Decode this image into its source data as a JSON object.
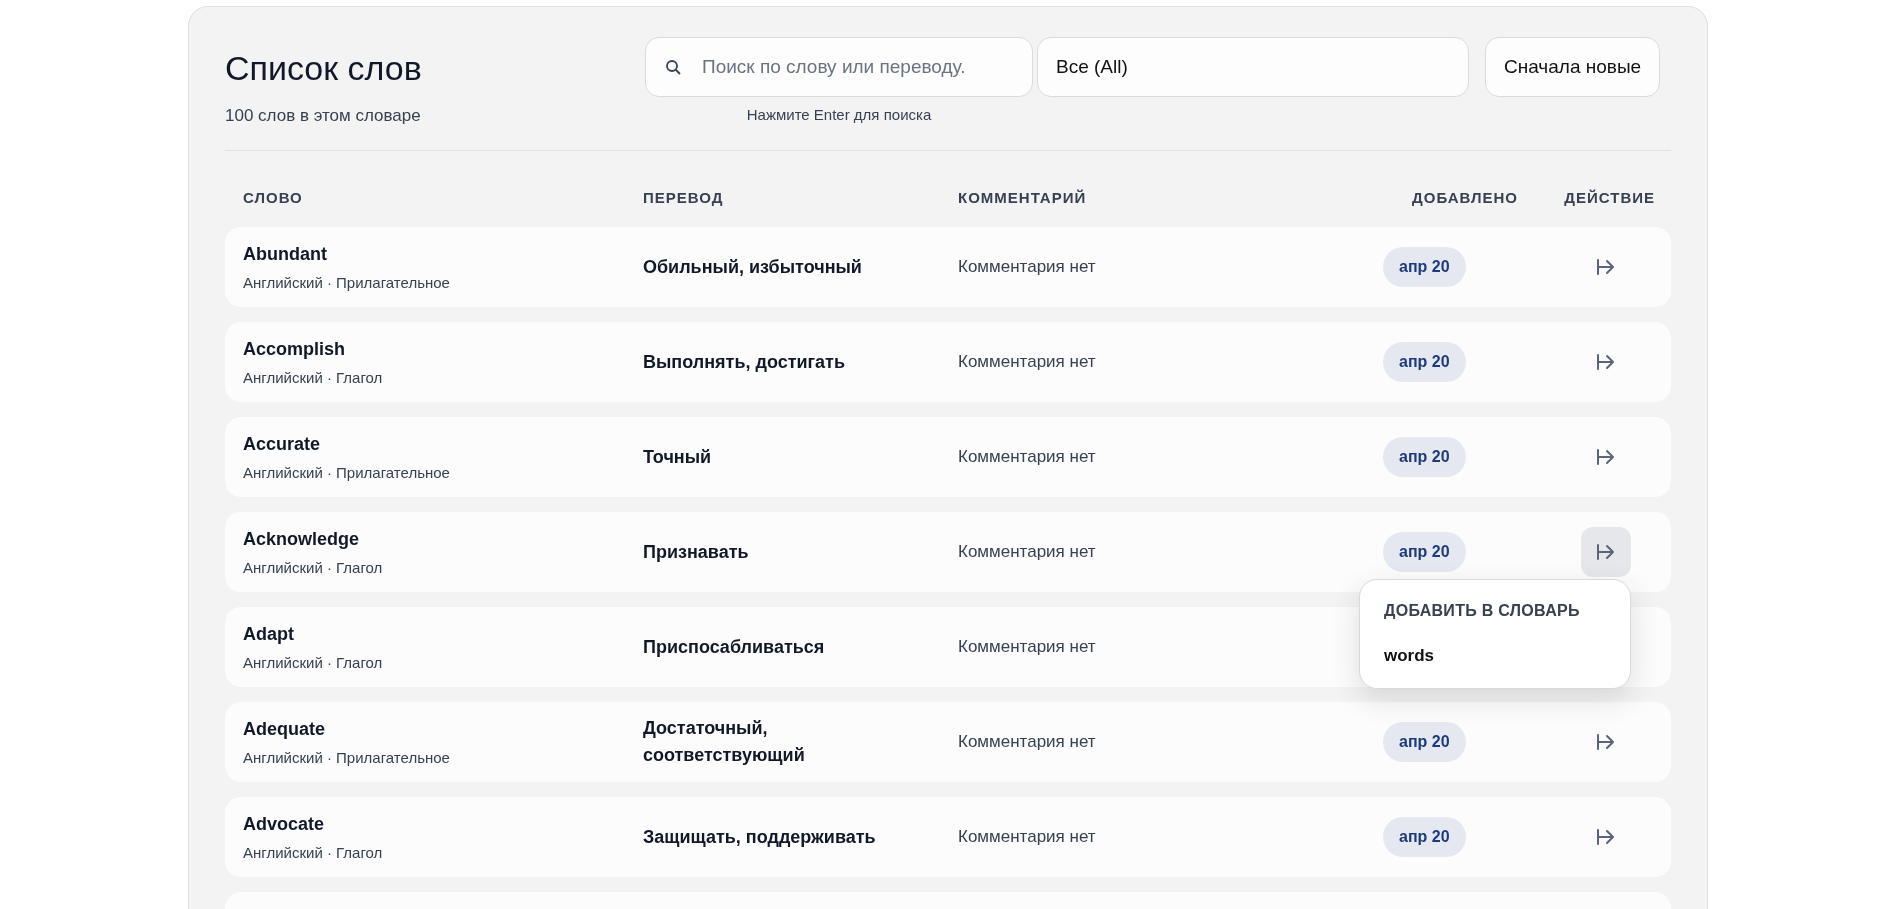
{
  "header": {
    "title": "Список слов",
    "subtitle": "100 слов в этом словаре"
  },
  "search": {
    "placeholder": "Поиск по слову или переводу.",
    "hint": "Нажмите Enter для поиска"
  },
  "filter": {
    "value": "Все (All)"
  },
  "sort": {
    "label": "Сначала новые"
  },
  "table": {
    "columns": [
      "СЛОВО",
      "ПЕРЕВОД",
      "КОММЕНТАРИЙ",
      "ДОБАВЛЕНО",
      "ДЕЙСТВИЕ"
    ],
    "rows": [
      {
        "word": "Abundant",
        "meta": "Английский · Прилагательное",
        "translation": "Обильный, избыточный",
        "comment": "Комментария нет",
        "date": "апр 20",
        "menu_open": false
      },
      {
        "word": "Accomplish",
        "meta": "Английский · Глагол",
        "translation": "Выполнять, достигать",
        "comment": "Комментария нет",
        "date": "апр 20",
        "menu_open": false
      },
      {
        "word": "Accurate",
        "meta": "Английский · Прилагательное",
        "translation": "Точный",
        "comment": "Комментария нет",
        "date": "апр 20",
        "menu_open": false
      },
      {
        "word": "Acknowledge",
        "meta": "Английский · Глагол",
        "translation": "Признавать",
        "comment": "Комментария нет",
        "date": "апр 20",
        "menu_open": true
      },
      {
        "word": "Adapt",
        "meta": "Английский · Глагол",
        "translation": "Приспосабливаться",
        "comment": "Комментария нет"
      },
      {
        "word": "Adequate",
        "meta": "Английский · Прилагательное",
        "translation": "Достаточный, соответствующий",
        "comment": "Комментария нет",
        "date": "апр 20",
        "menu_open": false
      },
      {
        "word": "Advocate",
        "meta": "Английский · Глагол",
        "translation": "Защищать, поддерживать",
        "comment": "Комментария нет",
        "date": "апр 20",
        "menu_open": false
      }
    ]
  },
  "menu": {
    "heading": "ДОБАВИТЬ В СЛОВАРЬ",
    "items": [
      "words"
    ]
  }
}
